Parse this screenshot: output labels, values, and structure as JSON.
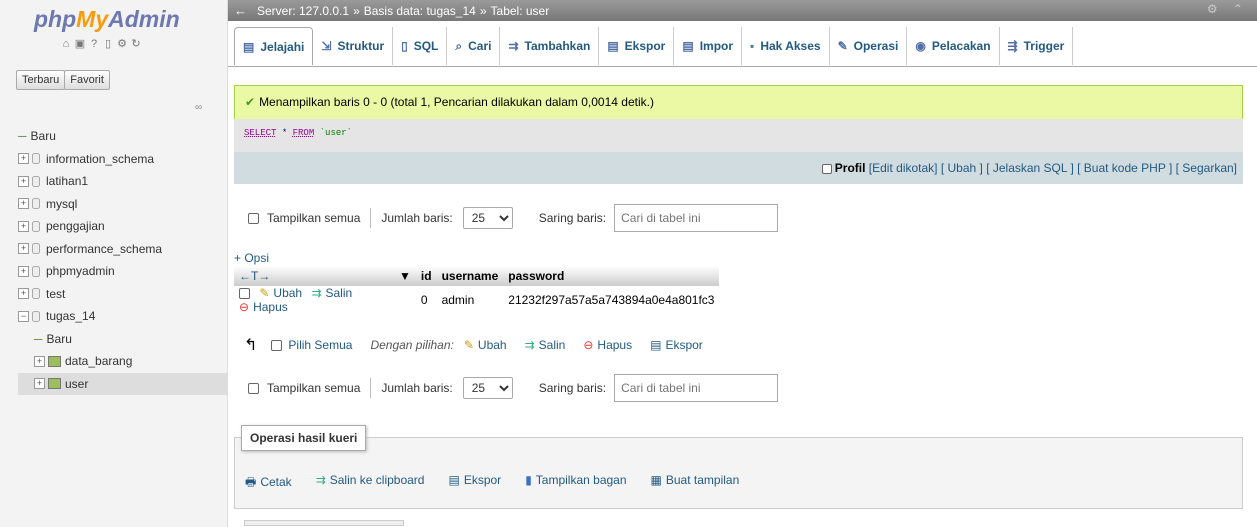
{
  "logo": {
    "php": "php",
    "my": "My",
    "admin": "Admin"
  },
  "left": {
    "tabs": [
      "Terbaru",
      "Favorit"
    ],
    "tree": [
      {
        "label": "Baru",
        "type": "new",
        "level": 0
      },
      {
        "label": "information_schema",
        "type": "db",
        "level": 0
      },
      {
        "label": "latihan1",
        "type": "db",
        "level": 0
      },
      {
        "label": "mysql",
        "type": "db",
        "level": 0
      },
      {
        "label": "penggajian",
        "type": "db",
        "level": 0
      },
      {
        "label": "performance_schema",
        "type": "db",
        "level": 0
      },
      {
        "label": "phpmyadmin",
        "type": "db",
        "level": 0
      },
      {
        "label": "test",
        "type": "db",
        "level": 0
      },
      {
        "label": "tugas_14",
        "type": "db-open",
        "level": 0
      },
      {
        "label": "Baru",
        "type": "new",
        "level": 1
      },
      {
        "label": "data_barang",
        "type": "table",
        "level": 1
      },
      {
        "label": "user",
        "type": "table",
        "level": 1
      }
    ]
  },
  "breadcrumb": {
    "server": "Server: 127.0.0.1",
    "db": "Basis data: tugas_14",
    "table": "Tabel: user",
    "sep": "»"
  },
  "tabs": [
    {
      "label": "Jelajahi",
      "icon": "browse-icon"
    },
    {
      "label": "Struktur",
      "icon": "structure-icon"
    },
    {
      "label": "SQL",
      "icon": "sql-icon"
    },
    {
      "label": "Cari",
      "icon": "search-icon"
    },
    {
      "label": "Tambahkan",
      "icon": "insert-icon"
    },
    {
      "label": "Ekspor",
      "icon": "export-icon"
    },
    {
      "label": "Impor",
      "icon": "import-icon"
    },
    {
      "label": "Hak Akses",
      "icon": "privileges-icon"
    },
    {
      "label": "Operasi",
      "icon": "operations-icon"
    },
    {
      "label": "Pelacakan",
      "icon": "tracking-icon"
    },
    {
      "label": "Trigger",
      "icon": "trigger-icon"
    }
  ],
  "success": "Menampilkan baris 0 - 0 (total 1, Pencarian dilakukan dalam 0,0014 detik.)",
  "sql": {
    "select": "SELECT",
    "star": "*",
    "from": "FROM",
    "table": "`user`"
  },
  "profbar": {
    "profil": "Profil",
    "links": "[Edit dikotak] [ Ubah ] [ Jelaskan SQL ] [ Buat kode PHP ] [ Segarkan]"
  },
  "nav": {
    "show_all": "Tampilkan semua",
    "rows_label": "Jumlah baris:",
    "rows_value": "25",
    "filter_label": "Saring baris:",
    "filter_placeholder": "Cari di tabel ini"
  },
  "opsi": "+ Opsi",
  "table": {
    "arrows": "←T→",
    "sort": "▼",
    "columns": [
      "id",
      "username",
      "password"
    ],
    "rows": [
      {
        "actions": [
          "Ubah",
          "Salin",
          "Hapus"
        ],
        "id": "0",
        "username": "admin",
        "password": "21232f297a57a5a743894a0e4a801fc3"
      }
    ]
  },
  "bulk": {
    "check_all": "Pilih Semua",
    "with_selected": "Dengan pilihan:",
    "actions": [
      "Ubah",
      "Salin",
      "Hapus",
      "Ekspor"
    ]
  },
  "ops": {
    "legend": "Operasi hasil kueri",
    "items": [
      "Cetak",
      "Salin ke clipboard",
      "Ekspor",
      "Tampilkan bagan",
      "Buat tampilan"
    ]
  },
  "colors": {
    "accent": "#235a81",
    "success_bg": "#ebf8a4",
    "topbar": "#888888"
  }
}
